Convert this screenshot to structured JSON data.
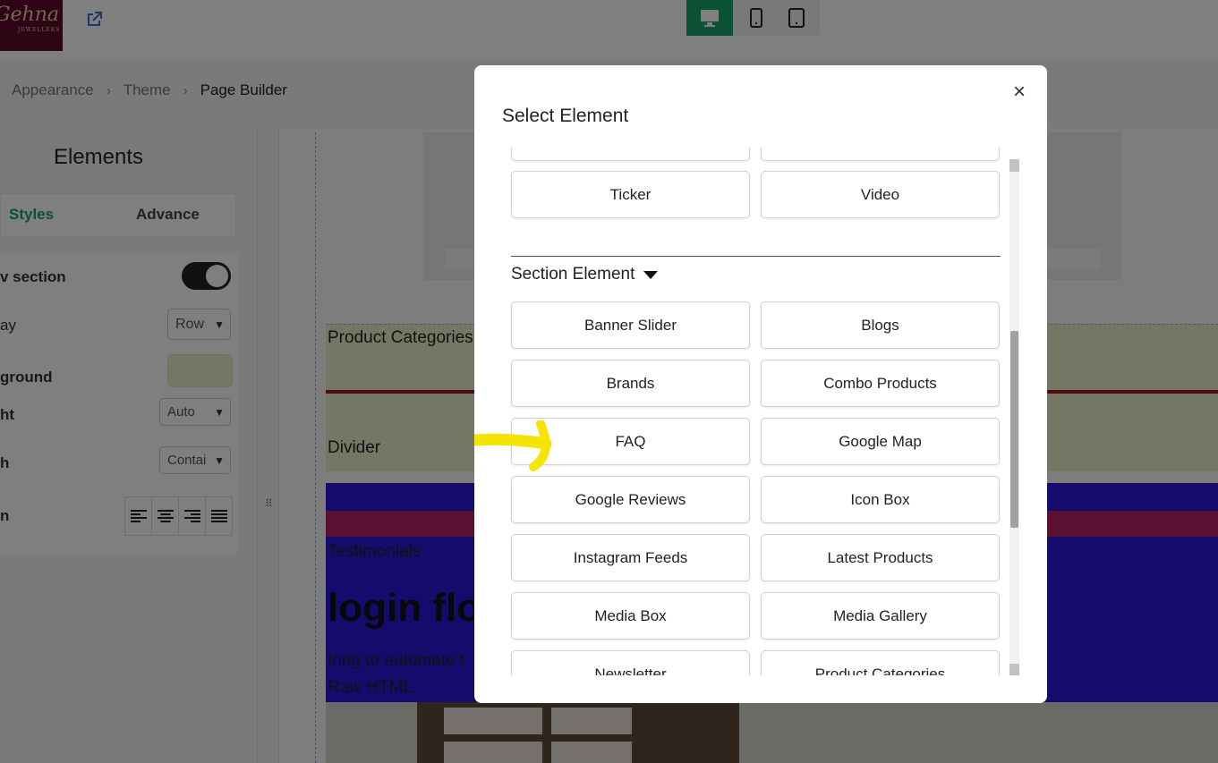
{
  "topbar": {
    "logo_text": "Gehna",
    "logo_subtext": "JEWELLERS",
    "devices": [
      "desktop-icon",
      "mobile-icon",
      "tablet-icon"
    ],
    "active_device": "desktop"
  },
  "breadcrumb": [
    "Appearance",
    "Theme",
    "Page Builder"
  ],
  "left_panel": {
    "title": "Elements",
    "tabs": [
      "Styles",
      "Advance"
    ],
    "active_tab": "Styles",
    "props": {
      "show_section_label": "v section",
      "display_label": "ay",
      "display_value": "Row",
      "background_label": "ground",
      "height_label": "ht",
      "height_value": "Auto",
      "width_label": "h",
      "width_value": "Contai",
      "align_label": "n"
    },
    "background_color": "#e6efc9"
  },
  "canvas": {
    "product_categories": "Product Categories",
    "divider": "Divider",
    "testimonials": "Testimonials",
    "heading": "login flo",
    "paragraph": "tring to automate t",
    "raw_html": "Raw HTML"
  },
  "modal": {
    "title": "Select Element",
    "close": "×",
    "top_items": [
      "Ticker",
      "Video"
    ],
    "section_title": "Section Element",
    "section_items": [
      "Banner Slider",
      "Blogs",
      "Brands",
      "Combo Products",
      "FAQ",
      "Google Map",
      "Google Reviews",
      "Icon Box",
      "Instagram Feeds",
      "Latest Products",
      "Media Box",
      "Media Gallery",
      "Newsletter",
      "Product Categories"
    ]
  },
  "colors": {
    "accent": "#16a26b",
    "highlight_arrow": "#f5e400",
    "testimonial_bg": "#2b17d8",
    "divider_red": "#a4122b"
  }
}
